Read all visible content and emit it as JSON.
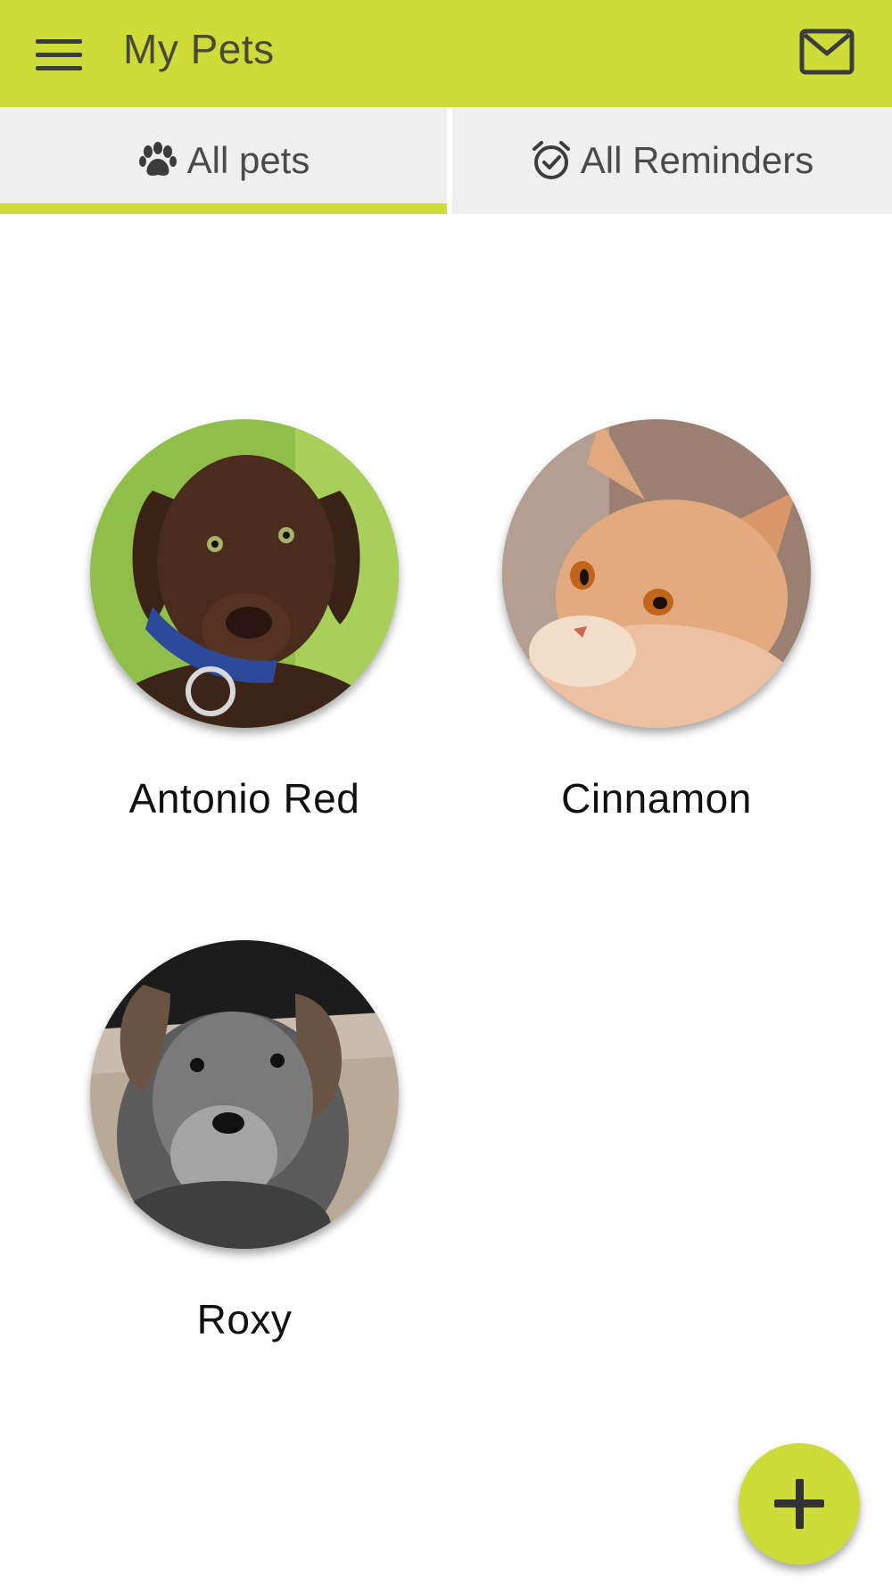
{
  "app": {
    "title": "My Pets",
    "accent_color": "#cddc39"
  },
  "appbar": {
    "menu_icon": "hamburger-menu-icon",
    "mail_icon": "mail-icon"
  },
  "tabs": [
    {
      "label": "All pets",
      "icon": "paw-icon",
      "selected": true
    },
    {
      "label": "All Reminders",
      "icon": "alarm-check-icon",
      "selected": false
    }
  ],
  "pets": [
    {
      "name": "Antonio Red",
      "photo": "chocolate-labrador-puppy"
    },
    {
      "name": "Cinnamon",
      "photo": "orange-tabby-cat"
    },
    {
      "name": "Roxy",
      "photo": "schnauzer-puppy"
    }
  ],
  "fab": {
    "icon": "plus-icon"
  }
}
